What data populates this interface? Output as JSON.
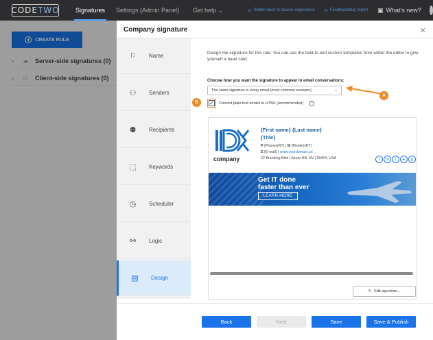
{
  "topbar": {
    "logo_code": "CODE",
    "logo_two": "TWO",
    "nav": [
      "Signatures",
      "Settings (Admin Panel)",
      "Get help"
    ],
    "switch_link": "Switch back to classic experience",
    "feedback_link": "Feedback/bug report",
    "whats_new": "What's new?"
  },
  "background": {
    "create_rule": "CREATE RULE",
    "tree": [
      {
        "label": "Server-side signatures (0)"
      },
      {
        "label": "Client-side signatures (0)"
      }
    ]
  },
  "dialog": {
    "title": "Company signature",
    "steps": [
      {
        "label": "Name",
        "icon": "signpost-icon"
      },
      {
        "label": "Senders",
        "icon": "senders-icon"
      },
      {
        "label": "Recipients",
        "icon": "recipients-icon"
      },
      {
        "label": "Keywords",
        "icon": "keywords-icon"
      },
      {
        "label": "Scheduler",
        "icon": "clock-icon"
      },
      {
        "label": "Logic",
        "icon": "logic-icon"
      },
      {
        "label": "Design",
        "icon": "design-icon",
        "active": true
      }
    ],
    "description": "Design the signature for this rule. You can use the built-in and custom templates from within the editor to give yourself a head start.",
    "choose_label": "Choose how you want the signature to appear in email conversations:",
    "select_value": "The same signature in every email (most common scenario)",
    "checkbox_label": "Convert plain text emails to HTML (recommended)",
    "checkbox_checked": true,
    "marker_a": "A",
    "marker_b": "B",
    "signature": {
      "company": "company",
      "name": "{First name} {Last name}",
      "title": "{Title}",
      "phone_p": "P",
      "phone_text": "{Phone}(RT) |",
      "mobile_m": "M",
      "mobile_text": "{Mobile}(RT)",
      "email_e": "E",
      "email_text": "{E-mail} |",
      "url": "www.yourdomain.url",
      "address": "22 Branding Blvd | Azure Hill, NV | 89404, USA",
      "banner_line1": "Get IT done",
      "banner_line2": "faster than ever",
      "banner_button": "LEARN MORE"
    },
    "edit_signature": "Edit signature...",
    "buttons": {
      "back": "Back",
      "next": "Next",
      "save": "Save",
      "save_publish": "Save & Publish"
    }
  },
  "colors": {
    "accent": "#1a73e8",
    "marker": "#f08a24",
    "topbar": "#2d2d30"
  }
}
